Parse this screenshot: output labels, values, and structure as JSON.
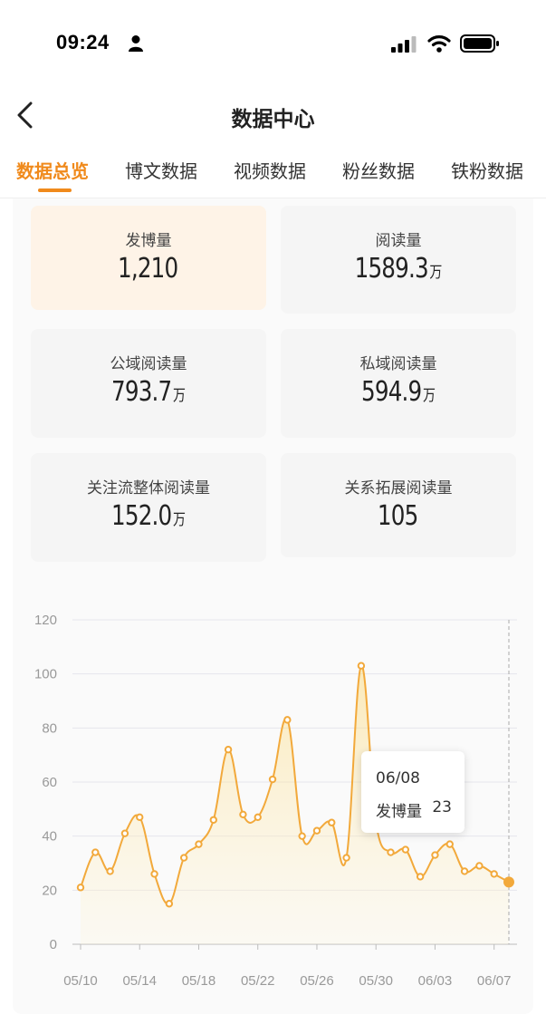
{
  "status_bar": {
    "time": "09:24"
  },
  "nav": {
    "title": "数据中心",
    "back_icon": "chevron-left-icon"
  },
  "tabs": [
    {
      "label": "数据总览",
      "active": true
    },
    {
      "label": "博文数据",
      "active": false
    },
    {
      "label": "视频数据",
      "active": false
    },
    {
      "label": "粉丝数据",
      "active": false
    },
    {
      "label": "铁粉数据",
      "active": false
    }
  ],
  "stats": [
    {
      "label": "发博量",
      "value": "1,210",
      "unit": ""
    },
    {
      "label": "阅读量",
      "value": "1589.3",
      "unit": "万"
    },
    {
      "label": "公域阅读量",
      "value": "793.7",
      "unit": "万"
    },
    {
      "label": "私域阅读量",
      "value": "594.9",
      "unit": "万"
    },
    {
      "label": "关注流整体阅读量",
      "value": "152.0",
      "unit": "万"
    },
    {
      "label": "关系拓展阅读量",
      "value": "105",
      "unit": ""
    }
  ],
  "colors": {
    "accent": "#f08a1c",
    "line": "#f2a93b",
    "highlight_card": "#fef3e7"
  },
  "tooltip": {
    "date": "06/08",
    "series": "发博量",
    "value": "23"
  },
  "chart_data": {
    "type": "area",
    "x": [
      "05/10",
      "05/11",
      "05/12",
      "05/13",
      "05/14",
      "05/15",
      "05/16",
      "05/17",
      "05/18",
      "05/19",
      "05/20",
      "05/21",
      "05/22",
      "05/23",
      "05/24",
      "05/25",
      "05/26",
      "05/27",
      "05/28",
      "05/29",
      "05/30",
      "05/31",
      "06/01",
      "06/02",
      "06/03",
      "06/04",
      "06/05",
      "06/06",
      "06/07",
      "06/08"
    ],
    "series": [
      {
        "name": "发博量",
        "values": [
          21,
          34,
          27,
          41,
          47,
          26,
          15,
          32,
          37,
          46,
          72,
          48,
          47,
          61,
          83,
          40,
          42,
          45,
          32,
          103,
          45,
          34,
          35,
          25,
          33,
          37,
          27,
          29,
          26,
          23
        ]
      }
    ],
    "x_tick_labels": [
      "05/10",
      "05/14",
      "05/18",
      "05/22",
      "05/26",
      "05/30",
      "06/03",
      "06/07"
    ],
    "y_ticks": [
      0,
      20,
      40,
      60,
      80,
      100,
      120
    ],
    "ylim": [
      0,
      120
    ],
    "grid": true,
    "highlighted_point": "06/08"
  }
}
